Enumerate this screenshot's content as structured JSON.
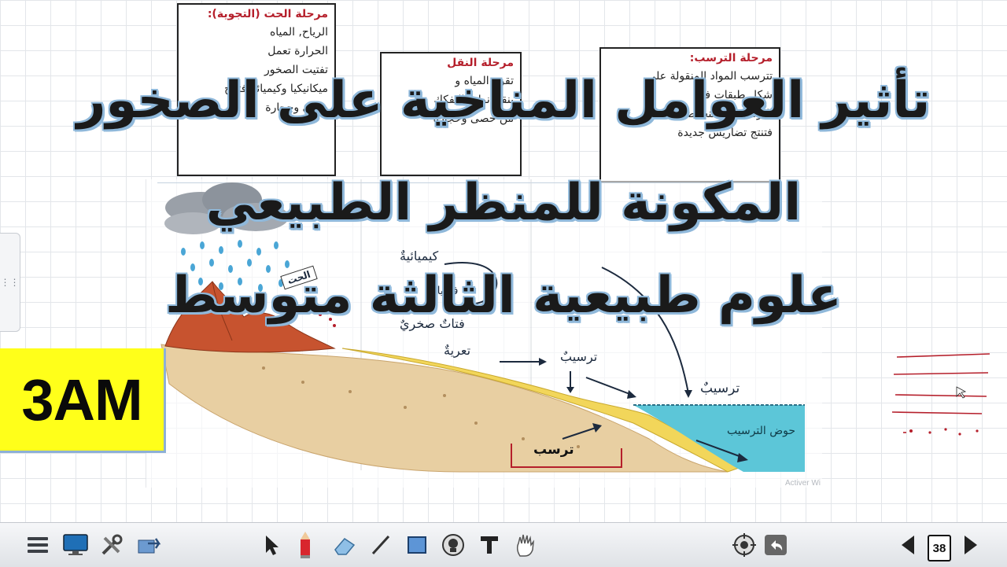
{
  "stage_boxes": {
    "weathering": {
      "title": "مرحلة الحت (التجوية):",
      "lines": [
        "الرياح, المياه",
        "الحرارة تعمل",
        "تفتيت الصخور",
        "ميكانيكيا وكيميائيا فتنتج",
        "حصى وحجارة"
      ]
    },
    "transport": {
      "title": "مرحلة النقل",
      "lines": [
        "تقوم المياه و",
        "بنقل نواتج التفكك",
        "من حصى وحجارة"
      ]
    },
    "deposition": {
      "title": "مرحلة الترسب:",
      "lines": [
        "تترسب المواد المنقولة على",
        "شكل طبقات في",
        "الترسيب والمنخفضات",
        "فتنتج تضاريس جديدة"
      ]
    }
  },
  "diagram": {
    "labels": {
      "weathering_tag": "الحت",
      "chemical": "كيميائيةٌ",
      "physical": "فيزيائيةٌ",
      "fragments": "فتاتٌ صخريٌ",
      "erosion": "تعريةٌ",
      "deposition_1": "ترسيبٌ",
      "deposition_2": "ترسيبٌ",
      "sediment": "ترسب",
      "basin": "حوض الترسيب"
    }
  },
  "title": {
    "line1": "تأثير العوامل المناخية على الصخور",
    "line2": "المكونة للمنظر الطبيعي",
    "line3": "علوم طبيعية الثالثة متوسط"
  },
  "badge": {
    "text": "3AM"
  },
  "watermark": "Activer Wi",
  "toolbar": {
    "page_number": "38",
    "icons": [
      "menu-icon",
      "monitor-icon",
      "tools-icon",
      "export-icon",
      "pointer-icon",
      "pencil-icon",
      "eraser-icon",
      "line-icon",
      "rectangle-icon",
      "spotlight-icon",
      "text-icon",
      "hand-icon",
      "target-icon",
      "undo-icon",
      "prev-page-icon",
      "next-page-icon"
    ]
  },
  "colors": {
    "accent_red": "#b51f2b",
    "title_shadow": "#8fb8da",
    "badge_bg": "#ffff1a",
    "water": "#5cc6d8"
  }
}
